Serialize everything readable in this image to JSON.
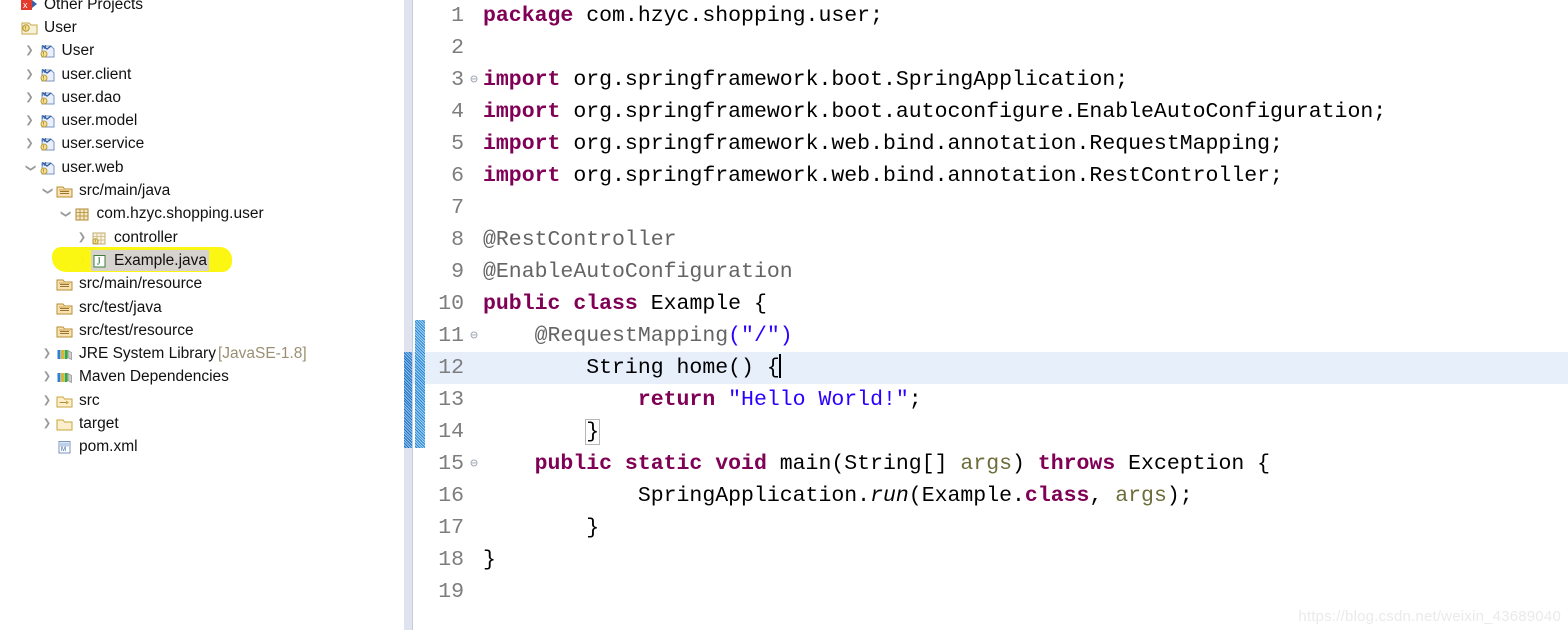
{
  "explorer": {
    "name": "package-explorer",
    "rows": [
      {
        "label": "Other Projects",
        "indent": 0,
        "arrow": "none",
        "icon": "closed-project-icon",
        "sub": "",
        "highlight": false,
        "selected": false,
        "clipped_top": true
      },
      {
        "label": "User",
        "indent": 0,
        "arrow": "none",
        "icon": "java-project-icon",
        "sub": "",
        "highlight": false,
        "selected": false
      },
      {
        "label": "User",
        "indent": 1,
        "arrow": "collapsed",
        "icon": "maven-module-icon",
        "sub": "",
        "highlight": false,
        "selected": false
      },
      {
        "label": "user.client",
        "indent": 1,
        "arrow": "collapsed",
        "icon": "maven-module-icon",
        "sub": "",
        "highlight": false,
        "selected": false
      },
      {
        "label": "user.dao",
        "indent": 1,
        "arrow": "collapsed",
        "icon": "maven-module-icon",
        "sub": "",
        "highlight": false,
        "selected": false
      },
      {
        "label": "user.model",
        "indent": 1,
        "arrow": "collapsed",
        "icon": "maven-module-icon",
        "sub": "",
        "highlight": false,
        "selected": false
      },
      {
        "label": "user.service",
        "indent": 1,
        "arrow": "collapsed",
        "icon": "maven-module-icon",
        "sub": "",
        "highlight": false,
        "selected": false
      },
      {
        "label": "user.web",
        "indent": 1,
        "arrow": "expanded",
        "icon": "maven-module-icon",
        "sub": "",
        "highlight": false,
        "selected": false
      },
      {
        "label": "src/main/java",
        "indent": 2,
        "arrow": "expanded",
        "icon": "source-folder-icon",
        "sub": "",
        "highlight": false,
        "selected": false
      },
      {
        "label": "com.hzyc.shopping.user",
        "indent": 3,
        "arrow": "expanded",
        "icon": "package-icon",
        "sub": "",
        "highlight": false,
        "selected": false
      },
      {
        "label": "controller",
        "indent": 4,
        "arrow": "collapsed",
        "icon": "package-empty-icon",
        "sub": "",
        "highlight": false,
        "selected": false
      },
      {
        "label": "Example.java",
        "indent": 4,
        "arrow": "collapsed",
        "icon": "java-file-icon",
        "sub": "",
        "highlight": true,
        "selected": true
      },
      {
        "label": "src/main/resource",
        "indent": 2,
        "arrow": "none",
        "icon": "source-folder-icon",
        "sub": "",
        "highlight": false,
        "selected": false
      },
      {
        "label": "src/test/java",
        "indent": 2,
        "arrow": "none",
        "icon": "source-folder-icon",
        "sub": "",
        "highlight": false,
        "selected": false
      },
      {
        "label": "src/test/resource",
        "indent": 2,
        "arrow": "none",
        "icon": "source-folder-icon",
        "sub": "",
        "highlight": false,
        "selected": false
      },
      {
        "label": "JRE System Library",
        "indent": 2,
        "arrow": "collapsed",
        "icon": "library-icon",
        "sub": "[JavaSE-1.8]",
        "highlight": false,
        "selected": false
      },
      {
        "label": "Maven Dependencies",
        "indent": 2,
        "arrow": "collapsed",
        "icon": "library-icon",
        "sub": "",
        "highlight": false,
        "selected": false
      },
      {
        "label": "src",
        "indent": 2,
        "arrow": "collapsed",
        "icon": "folder-special-icon",
        "sub": "",
        "highlight": false,
        "selected": false
      },
      {
        "label": "target",
        "indent": 2,
        "arrow": "collapsed",
        "icon": "folder-icon",
        "sub": "",
        "highlight": false,
        "selected": false
      },
      {
        "label": "pom.xml",
        "indent": 2,
        "arrow": "none",
        "icon": "xml-file-icon",
        "sub": "",
        "highlight": false,
        "selected": false
      }
    ]
  },
  "editor": {
    "name": "java-source-editor",
    "file": "Example.java",
    "current_line": 12,
    "change_bar_lines": [
      11,
      12,
      13,
      14
    ],
    "fold_markers": [
      3,
      11,
      15
    ],
    "total_lines": 19,
    "lines": [
      {
        "n": 1,
        "fold": false,
        "tokens": [
          {
            "t": "package ",
            "c": "kw"
          },
          {
            "t": "com.hzyc.shopping.user;",
            "c": "pln"
          }
        ]
      },
      {
        "n": 2,
        "fold": false,
        "tokens": []
      },
      {
        "n": 3,
        "fold": true,
        "tokens": [
          {
            "t": "import ",
            "c": "kw"
          },
          {
            "t": "org.springframework.boot.SpringApplication;",
            "c": "pln"
          }
        ]
      },
      {
        "n": 4,
        "fold": false,
        "tokens": [
          {
            "t": "import ",
            "c": "kw"
          },
          {
            "t": "org.springframework.boot.autoconfigure.EnableAutoConfiguration;",
            "c": "pln"
          }
        ]
      },
      {
        "n": 5,
        "fold": false,
        "tokens": [
          {
            "t": "import ",
            "c": "kw"
          },
          {
            "t": "org.springframework.web.bind.annotation.RequestMapping;",
            "c": "pln"
          }
        ]
      },
      {
        "n": 6,
        "fold": false,
        "tokens": [
          {
            "t": "import ",
            "c": "kw"
          },
          {
            "t": "org.springframework.web.bind.annotation.RestController;",
            "c": "pln"
          }
        ]
      },
      {
        "n": 7,
        "fold": false,
        "tokens": []
      },
      {
        "n": 8,
        "fold": false,
        "tokens": [
          {
            "t": "@RestController",
            "c": "ann"
          }
        ]
      },
      {
        "n": 9,
        "fold": false,
        "tokens": [
          {
            "t": "@EnableAutoConfiguration",
            "c": "ann"
          }
        ]
      },
      {
        "n": 10,
        "fold": false,
        "tokens": [
          {
            "t": "public class ",
            "c": "kw"
          },
          {
            "t": "Example {",
            "c": "pln"
          }
        ]
      },
      {
        "n": 11,
        "fold": true,
        "tokens": [
          {
            "t": "    @RequestMapping",
            "c": "ann"
          },
          {
            "t": "(",
            "c": "annp"
          },
          {
            "t": "\"/\"",
            "c": "str"
          },
          {
            "t": ")",
            "c": "annp"
          }
        ]
      },
      {
        "n": 12,
        "fold": false,
        "tokens": [
          {
            "t": "        String home() {",
            "c": "pln"
          },
          {
            "t": "",
            "c": "caret"
          }
        ]
      },
      {
        "n": 13,
        "fold": false,
        "tokens": [
          {
            "t": "            ",
            "c": "pln"
          },
          {
            "t": "return ",
            "c": "kw"
          },
          {
            "t": "\"Hello World!\"",
            "c": "str"
          },
          {
            "t": ";",
            "c": "pln"
          }
        ]
      },
      {
        "n": 14,
        "fold": false,
        "tokens": [
          {
            "t": "        ",
            "c": "pln"
          },
          {
            "t": "}",
            "c": "bracebox"
          }
        ]
      },
      {
        "n": 15,
        "fold": true,
        "tokens": [
          {
            "t": "    ",
            "c": "pln"
          },
          {
            "t": "public static void ",
            "c": "kw"
          },
          {
            "t": "main(String[] ",
            "c": "pln"
          },
          {
            "t": "args",
            "c": "prm"
          },
          {
            "t": ") ",
            "c": "pln"
          },
          {
            "t": "throws ",
            "c": "kw"
          },
          {
            "t": "Exception {",
            "c": "pln"
          }
        ]
      },
      {
        "n": 16,
        "fold": false,
        "tokens": [
          {
            "t": "            SpringApplication.",
            "c": "pln"
          },
          {
            "t": "run",
            "c": "stm"
          },
          {
            "t": "(Example.",
            "c": "pln"
          },
          {
            "t": "class",
            "c": "kw"
          },
          {
            "t": ", ",
            "c": "pln"
          },
          {
            "t": "args",
            "c": "prm"
          },
          {
            "t": ");",
            "c": "pln"
          }
        ]
      },
      {
        "n": 17,
        "fold": false,
        "tokens": [
          {
            "t": "        }",
            "c": "pln"
          }
        ]
      },
      {
        "n": 18,
        "fold": false,
        "tokens": [
          {
            "t": "}",
            "c": "pln"
          }
        ]
      },
      {
        "n": 19,
        "fold": false,
        "tokens": []
      }
    ]
  },
  "watermark": {
    "text": "https://blog.csdn.net/weixin_43689040"
  },
  "colors": {
    "keyword": "#7f0055",
    "string": "#2a00ff",
    "annotation": "#646464",
    "parameter": "#6d6d3a",
    "line_number": "#7d7d7d",
    "current_line_bg": "#e7effb",
    "marker_highlight": "#fbf70a",
    "selection_bg": "#d6d2cd",
    "change_bar": "#2389d8",
    "scrollbar_track": "#dfe3f0"
  }
}
